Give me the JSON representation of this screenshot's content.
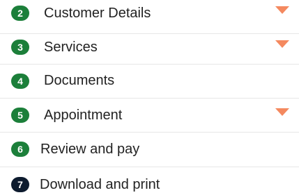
{
  "colors": {
    "badge_active": "#1c7f3a",
    "badge_current": "#0d1b2e",
    "caret": "#f4895f",
    "divider": "#e6e6e6",
    "text": "#222222"
  },
  "steps": [
    {
      "number": "2",
      "label": "Customer Details",
      "icon": "chevron-down-icon"
    },
    {
      "number": "3",
      "label": "Services",
      "icon": "chevron-down-icon"
    },
    {
      "number": "4",
      "label": "Documents"
    },
    {
      "number": "5",
      "label": "Appointment",
      "icon": "chevron-down-icon"
    },
    {
      "number": "6",
      "label": "Review and pay"
    },
    {
      "number": "7",
      "label": "Download and print"
    }
  ]
}
